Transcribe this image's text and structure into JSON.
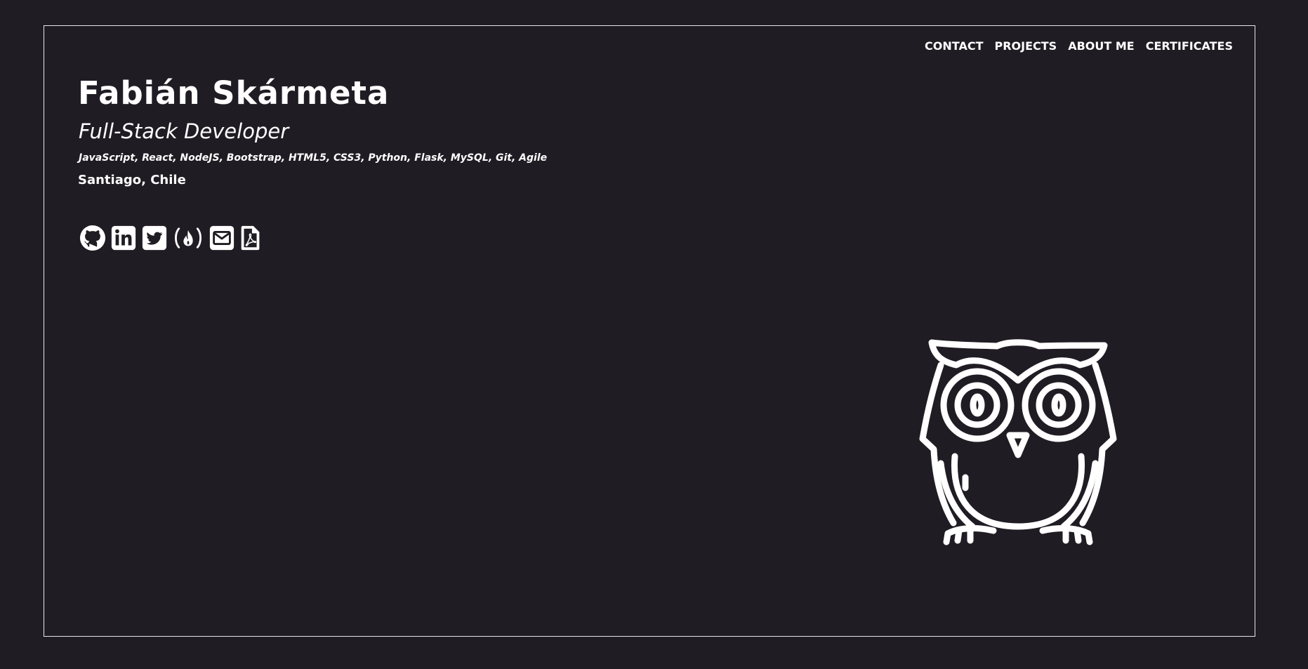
{
  "nav": {
    "items": [
      {
        "label": "CONTACT"
      },
      {
        "label": "PROJECTS"
      },
      {
        "label": "ABOUT ME"
      },
      {
        "label": "CERTIFICATES"
      }
    ]
  },
  "hero": {
    "name": "Fabián Skármeta",
    "role": "Full-Stack Developer",
    "skills": "JavaScript, React, NodeJS, Bootstrap, HTML5, CSS3, Python, Flask, MySQL, Git, Agile",
    "location": "Santiago, Chile"
  },
  "social": {
    "icons": [
      "github-icon",
      "linkedin-icon",
      "twitter-icon",
      "freecodecamp-icon",
      "envelope-icon",
      "pdf-file-icon"
    ]
  },
  "illustration": {
    "icon": "owl-icon"
  },
  "colors": {
    "background": "#201c23",
    "foreground": "#ffffff",
    "frame_border": "#e8e6ea"
  }
}
